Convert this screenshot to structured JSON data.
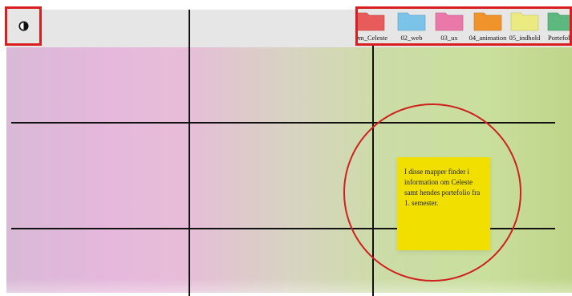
{
  "toolbar": {
    "contrast_icon": "contrast-icon",
    "accent_color": "#d81e1e"
  },
  "folders": [
    {
      "label": "Om_Celeste",
      "color": "#e85b5b"
    },
    {
      "label": "02_web",
      "color": "#7cc3ea"
    },
    {
      "label": "03_ux",
      "color": "#ea78a8"
    },
    {
      "label": "04_animation",
      "color": "#f0932b"
    },
    {
      "label": "05_indhold",
      "color": "#eaea80"
    },
    {
      "label": "Portefolio",
      "color": "#5cb87e"
    }
  ],
  "note": {
    "text": "I disse mapper finder i information om Celeste samt hendes portefolio fra 1. semester.",
    "color": "#f1df00"
  },
  "highlight_color": "#cf1f1f"
}
